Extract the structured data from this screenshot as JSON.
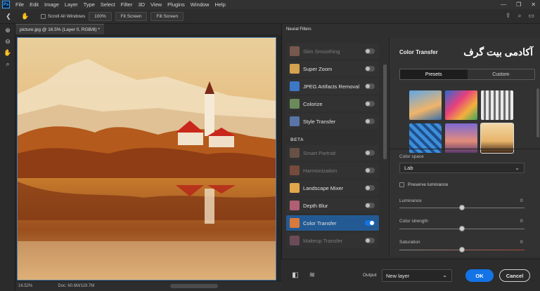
{
  "app": {
    "logo": "Ps"
  },
  "menu": [
    "File",
    "Edit",
    "Image",
    "Layer",
    "Type",
    "Select",
    "Filter",
    "3D",
    "View",
    "Plugins",
    "Window",
    "Help"
  ],
  "window_controls": {
    "minimize": "—",
    "restore": "❐",
    "close": "✕"
  },
  "options_bar": {
    "scroll_all_windows": "Scroll All Windows",
    "zoom_pct": "100%",
    "fit_screen": "Fit Screen",
    "fill_screen": "Fill Screen"
  },
  "document": {
    "tab_title": "picture.jpg @ 16.5% (Layer 0, RGB/8) *",
    "zoom": "16.52%",
    "doc_size": "Doc: 60.6M/119.7M"
  },
  "neural_filters": {
    "panel_title": "Neural Filters",
    "beta_label": "BETA",
    "featured": [
      {
        "label": "Skin Smoothing",
        "enabled": false,
        "on": false,
        "thumb": "#c98a6d"
      },
      {
        "label": "Super Zoom",
        "enabled": true,
        "on": false,
        "thumb": "#d5a24f"
      },
      {
        "label": "JPEG Artifacts Removal",
        "enabled": true,
        "on": false,
        "thumb": "#3d77c7"
      },
      {
        "label": "Colorize",
        "enabled": true,
        "on": false,
        "thumb": "#6b8a5a"
      },
      {
        "label": "Style Transfer",
        "enabled": true,
        "on": false,
        "thumb": "#5975a8"
      }
    ],
    "beta": [
      {
        "label": "Smart Portrait",
        "enabled": false,
        "on": false,
        "thumb": "#a7775a"
      },
      {
        "label": "Harmonization",
        "enabled": false,
        "on": false,
        "thumb": "#c76a4a"
      },
      {
        "label": "Landscape Mixer",
        "enabled": true,
        "on": false,
        "thumb": "#e1a74b"
      },
      {
        "label": "Depth Blur",
        "enabled": true,
        "on": false,
        "thumb": "#b05f72"
      },
      {
        "label": "Color Transfer",
        "enabled": true,
        "on": true,
        "thumb": "#d77a3c"
      },
      {
        "label": "Makeup Transfer",
        "enabled": false,
        "on": false,
        "thumb": "#b46a88"
      }
    ]
  },
  "color_transfer": {
    "title": "Color Transfer",
    "watermark": "آکادمی بیت گرف",
    "tabs": [
      "Presets",
      "Custom"
    ],
    "color_space_label": "Color space",
    "color_space_value": "Lab",
    "preserve_luminance": "Preserve luminance",
    "sliders": [
      {
        "label": "Luminance",
        "value": 0,
        "display": "0"
      },
      {
        "label": "Color strength",
        "value": 0,
        "display": "0"
      },
      {
        "label": "Saturation",
        "value": 0,
        "display": "0"
      }
    ]
  },
  "output": {
    "label": "Output",
    "value": "New layer",
    "ok": "OK",
    "cancel": "Cancel"
  },
  "colors": {
    "accent": "#1473e6",
    "active_item": "#235a93",
    "panel": "#2f2f2f"
  }
}
